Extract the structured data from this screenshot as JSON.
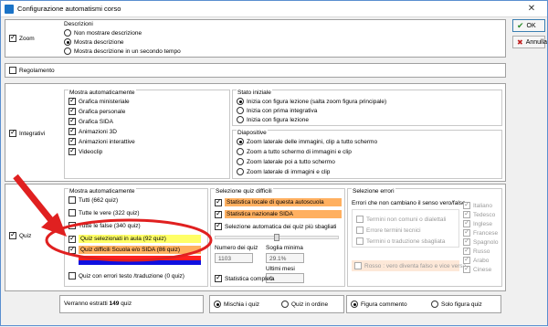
{
  "window": {
    "title": "Configurazione automatismi corso",
    "close": "✕"
  },
  "buttons": {
    "ok": "OK",
    "cancel": "Annulla"
  },
  "zoom": {
    "label": "Zoom",
    "descrizioni": {
      "title": "Descrizioni",
      "options": [
        "Non mostrare descrizione",
        "Mostra descrizione",
        "Mostra descrizione in un secondo tempo"
      ]
    }
  },
  "regolamento": {
    "label": "Regolamento"
  },
  "integrativi": {
    "label": "Integrativi",
    "mostra": {
      "title": "Mostra automaticamente",
      "items": [
        "Grafica ministeriale",
        "Grafica personale",
        "Grafica SIDA",
        "Animazioni 3D",
        "Animazioni interattive",
        "Videoclip"
      ]
    },
    "stato": {
      "title": "Stato iniziale",
      "options": [
        "Inizia con figura lezione (salta zoom figura principale)",
        "Inizia con prima integrativa",
        "Inizia con figura lezione"
      ]
    },
    "diapositive": {
      "title": "Diapositive",
      "options": [
        "Zoom laterale delle immagini, clip a tutto schermo",
        "Zoom a tutto schermo di immagini e clip",
        "Zoom laterale poi a tutto schermo",
        "Zoom laterale di immagini e clip"
      ]
    }
  },
  "quiz": {
    "label": "Quiz",
    "mostra": {
      "title": "Mostra automaticamente",
      "tutti": "Tutti (662 quiz)",
      "vere": "Tutte le vere (322 quiz)",
      "false": "Tutte le false (340 quiz)",
      "aula": "Quiz selezionati in aula (92 quiz)",
      "difficili": "Quiz difficili Scuola e/o SIDA (86 quiz)",
      "errori": "Quiz con errori testo /traduzione (0 quiz)"
    },
    "difficili": {
      "title": "Selezione quiz difficili",
      "locale": "Statistica locale di questa autoscuola",
      "nazionale": "Statistica nazionale SIDA",
      "automatica": "Selezione automatica dei quiz più sbagliati",
      "numero_label": "Numero dei quiz",
      "numero_value": "1103",
      "soglia_label": "Soglia minima",
      "soglia_value": "29.1%",
      "ultimi_label": "Ultimi mesi",
      "ultimi_value": "0",
      "completa": "Statistica completa"
    },
    "errori": {
      "title": "Selezione errori",
      "subtitle": "Errori che non cambiano il senso vero/falso",
      "types": [
        "Termini non comuni o dialettali",
        "Errore termini tecnici",
        "Termini o traduzione sbagliata"
      ],
      "rosso": "Rosso : vero diventa falso e vice versa",
      "languages": [
        "Italiano",
        "Tedesco",
        "Inglese",
        "Francese",
        "Spagnolo",
        "Russo",
        "Arabo",
        "Cinese"
      ]
    },
    "footer": {
      "estratti_prefix": "Verranno estratti",
      "estratti_count": "149",
      "estratti_suffix": "quiz",
      "mischia": "Mischia i quiz",
      "ordine": "Quiz in ordine",
      "commento": "Figura commento",
      "solo": "Solo figura quiz"
    }
  },
  "colors": {
    "highlight_yellow": "#ffff66",
    "highlight_orange": "#ffb060",
    "blue_bar": "#1010e0",
    "red_bar": "#ff2020",
    "arrow": "#e02020",
    "circle": "#e02020"
  }
}
